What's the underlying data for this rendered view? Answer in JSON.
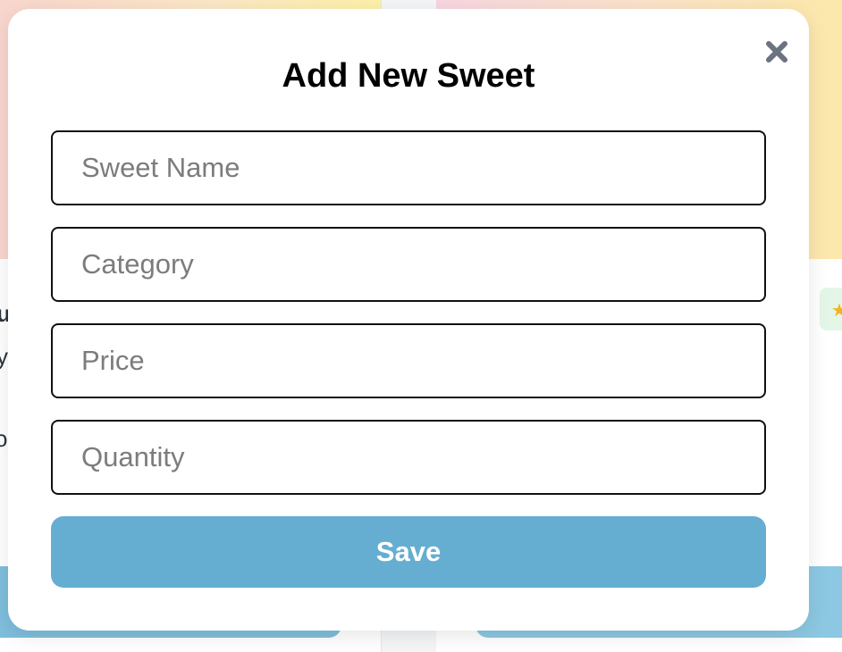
{
  "modal": {
    "title": "Add New Sweet",
    "close_icon": "close-x-icon",
    "fields": {
      "name_placeholder": "Sweet Name",
      "category_placeholder": "Category",
      "price_placeholder": "Price",
      "quantity_placeholder": "Quantity"
    },
    "save_label": "Save"
  },
  "colors": {
    "save_button": "#65aed2",
    "close_icon": "#6b7280",
    "modal_background": "#ffffff",
    "field_border": "#111111"
  },
  "background": {
    "left_card_partial_texts": [
      "u",
      "y",
      "o"
    ]
  }
}
